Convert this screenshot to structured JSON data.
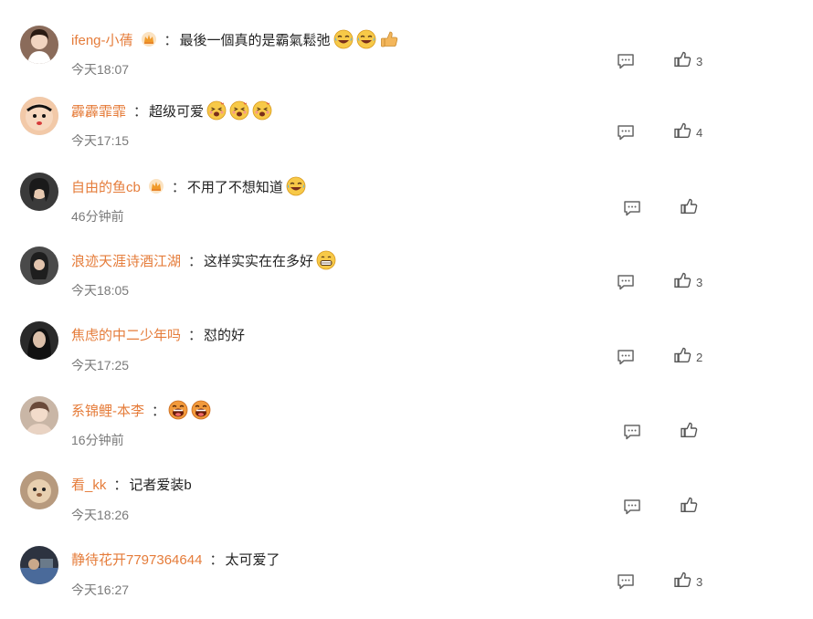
{
  "comments": [
    {
      "username": "ifeng-小蒨",
      "separator": "：",
      "text": "最後一個真的是霸氣鬆弛",
      "time": "今天18:07",
      "likes": "3",
      "badge": "crown-badge-icon",
      "emojis": [
        "laugh-cry-emoji",
        "laugh-cry-emoji",
        "thumbs-up-emoji"
      ],
      "avatar_color": "#8a6b5a"
    },
    {
      "username": "霹霹霏霏",
      "separator": "：",
      "text": "超级可爱",
      "time": "今天17:15",
      "likes": "4",
      "badge": "",
      "emojis": [
        "excited-emoji",
        "excited-emoji",
        "excited-emoji"
      ],
      "avatar_color": "#f2c9a8"
    },
    {
      "username": "自由的鱼cb",
      "separator": "：",
      "text": "不用了不想知道",
      "time": "46分钟前",
      "likes": "",
      "badge": "crown-badge-icon",
      "emojis": [
        "laugh-cry-emoji"
      ],
      "avatar_color": "#3a3a3a"
    },
    {
      "username": "浪迹天涯诗酒江湖",
      "separator": "：",
      "text": "这样实实在在多好",
      "time": "今天18:05",
      "likes": "3",
      "badge": "",
      "emojis": [
        "grin-emoji"
      ],
      "avatar_color": "#4a4a4a"
    },
    {
      "username": "焦虑的中二少年吗",
      "separator": "：",
      "text": "怼的好",
      "time": "今天17:25",
      "likes": "2",
      "badge": "",
      "emojis": [],
      "avatar_color": "#2a2a2a"
    },
    {
      "username": "系锦鲤-本李",
      "separator": "：",
      "text": "",
      "time": "16分钟前",
      "likes": "",
      "badge": "",
      "emojis": [
        "big-laugh-emoji",
        "big-laugh-emoji"
      ],
      "avatar_color": "#c9b6a6"
    },
    {
      "username": "看_kk",
      "separator": "：",
      "text": "记者爱装b",
      "time": "今天18:26",
      "likes": "",
      "badge": "",
      "emojis": [],
      "avatar_color": "#b79a7e"
    },
    {
      "username": "静待花开7797364644",
      "separator": "：",
      "text": "太可爱了",
      "time": "今天16:27",
      "likes": "3",
      "badge": "",
      "emojis": [],
      "avatar_color": "#2d3340"
    }
  ]
}
